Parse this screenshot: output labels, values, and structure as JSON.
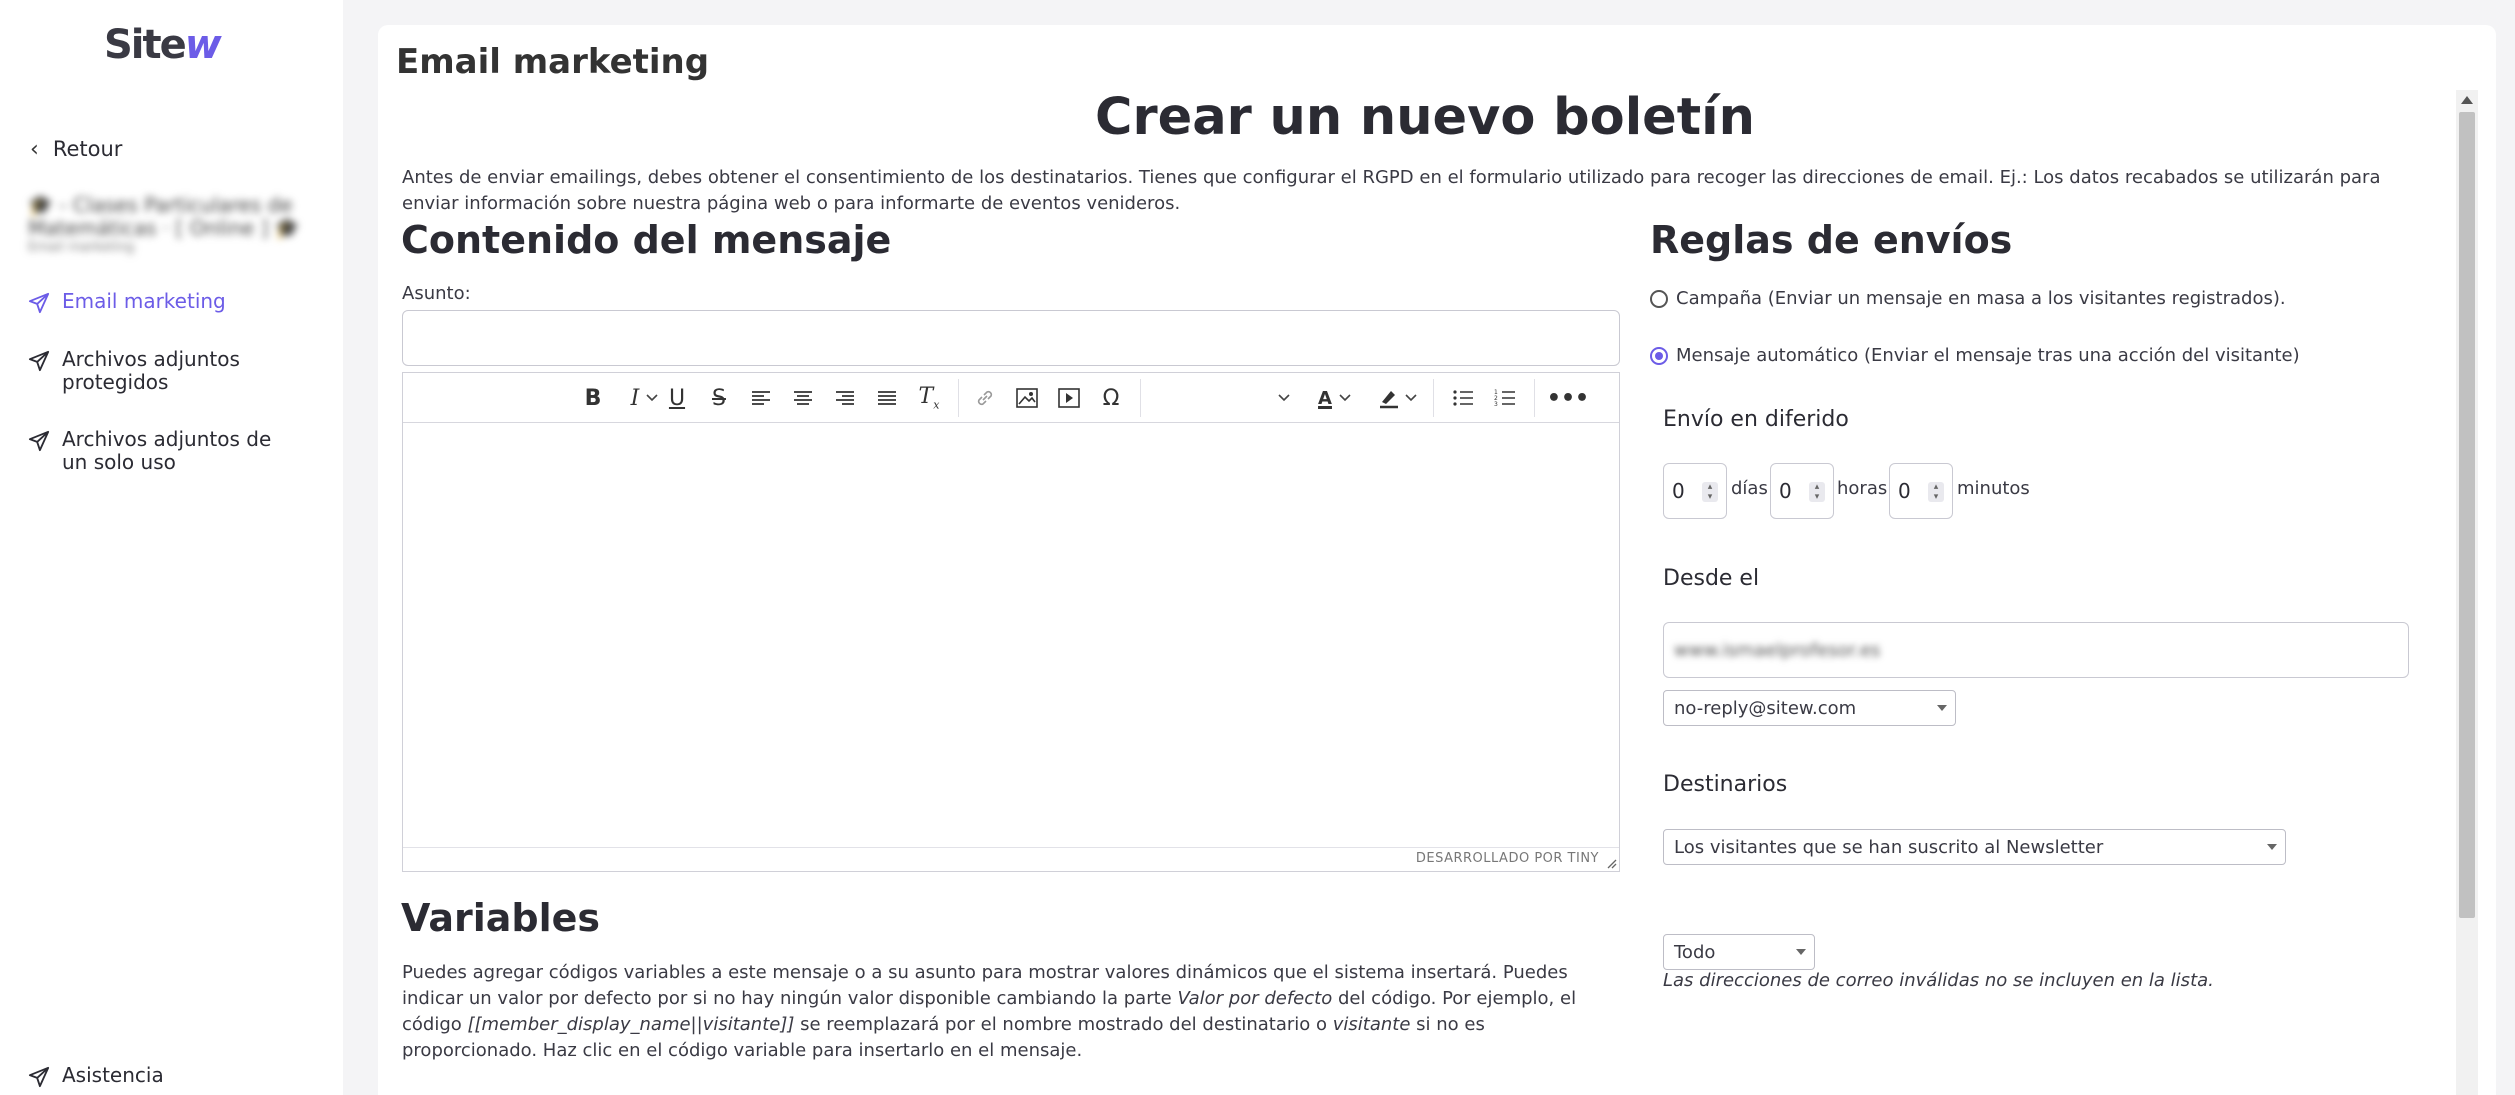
{
  "app": {
    "logo_main": "Site",
    "logo_accent": "w"
  },
  "sidebar": {
    "back_label": "Retour",
    "site_name": "🎓 - Clases Particulares de Matemáticas · [ Online ] 🎓",
    "site_sub": "Email marketing",
    "items": [
      {
        "label": "Email marketing",
        "active": true
      },
      {
        "label": "Archivos adjuntos protegidos"
      },
      {
        "label": "Archivos adjuntos de un solo uso"
      }
    ],
    "help_label": "Asistencia"
  },
  "colors": {
    "accent": "#6c5ce7",
    "text": "#2b2b33",
    "page_bg": "#f4f4f6"
  },
  "page": {
    "section_title": "Email marketing",
    "title": "Crear un nuevo boletín",
    "notice": "Antes de enviar emailings, debes obtener el consentimiento de los destinatarios. Tienes que configurar el RGPD en el formulario utilizado para recoger las direcciones de email. Ej.: Los datos recabados se utilizarán para enviar información sobre nuestra página web o para informarte de eventos venideros."
  },
  "content": {
    "heading": "Contenido del mensaje",
    "subject_label": "Asunto:",
    "subject_value": "",
    "editor_footer": "DESARROLLADO POR TINY"
  },
  "variables": {
    "heading": "Variables",
    "text_1": "Puedes agregar códigos variables a este mensaje o a su asunto para mostrar valores dinámicos que el sistema insertará. Puedes indicar un valor por defecto por si no hay ningún valor disponible cambiando la parte ",
    "text_em_1": "Valor por defecto",
    "text_2": " del código. Por ejemplo, el código ",
    "text_em_2": "[[member_display_name||visitante]]",
    "text_3": " se reemplazará por el nombre mostrado del destinatario o ",
    "text_em_3": "visitante",
    "text_4": " si no es proporcionado. Haz clic en el código variable para insertarlo en el mensaje."
  },
  "rules": {
    "heading": "Reglas de envíos",
    "campaign_label": "Campaña (Enviar un mensaje en masa a los visitantes registrados).",
    "auto_label": "Mensaje automático (Enviar el mensaje tras una acción del visitante)",
    "delay_heading": "Envío en diferido",
    "days_value": "0",
    "days_label": "días",
    "hours_value": "0",
    "hours_label": "horas",
    "minutes_value": "0",
    "minutes_label": "minutos",
    "from_heading": "Desde el",
    "from_value": "www.ismaelprofesor.es",
    "sender_selected": "no-reply@sitew.com",
    "recipients_heading": "Destinarios",
    "recipients_selected": "Los visitantes que se han suscrito al Newsletter",
    "filter_selected": "Todo",
    "invalid_note": "Las direcciones de correo inválidas no se incluyen en la lista."
  }
}
